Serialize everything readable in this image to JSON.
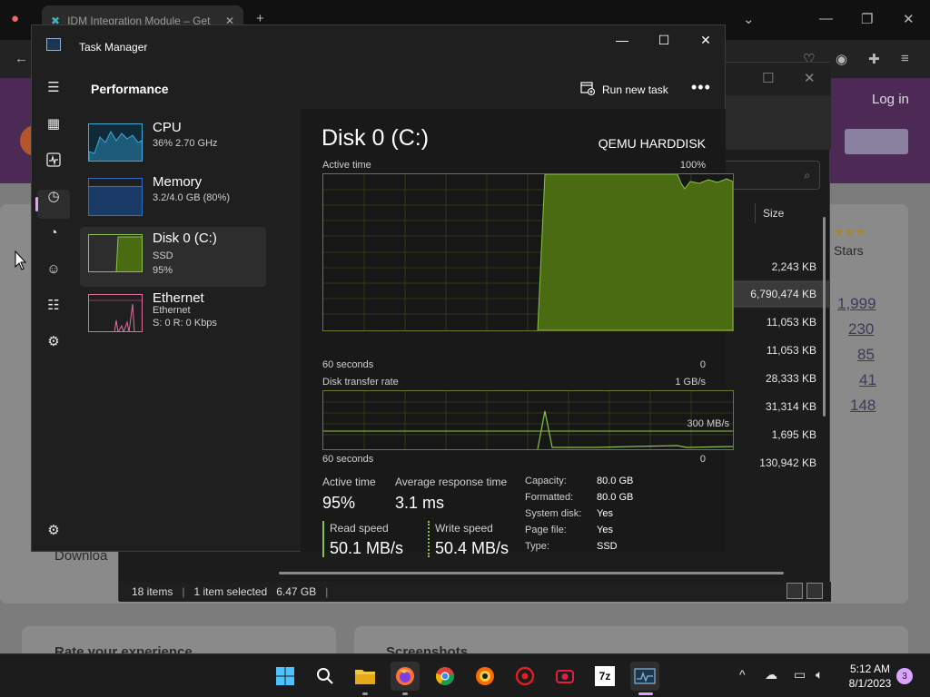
{
  "browser": {
    "tab_title": "IDM Integration Module – Get",
    "login": "Log in",
    "download": "Downloa",
    "rate_heading": "Rate your experience",
    "screenshots_heading": "Screenshots",
    "stars_label": "Stars",
    "ratings": [
      "1,999",
      "230",
      "85",
      "41",
      "148"
    ]
  },
  "explorer": {
    "column_size": "Size",
    "sizes": [
      "2,243 KB",
      "6,790,474 KB",
      "11,053 KB",
      "11,053 KB",
      "28,333 KB",
      "31,314 KB",
      "1,695 KB",
      "130,942 KB"
    ],
    "status_items": "18 items",
    "status_selected": "1 item selected",
    "status_size": "6.47 GB"
  },
  "taskmanager": {
    "title": "Task Manager",
    "header": "Performance",
    "run_new_task": "Run new task",
    "items": [
      {
        "name": "CPU",
        "sub1": "36%  2.70 GHz",
        "sub2": "",
        "sub3": ""
      },
      {
        "name": "Memory",
        "sub1": "3.2/4.0 GB (80%)",
        "sub2": "",
        "sub3": ""
      },
      {
        "name": "Disk 0 (C:)",
        "sub1": "SSD",
        "sub2": "95%",
        "sub3": ""
      },
      {
        "name": "Ethernet",
        "sub1": "Ethernet",
        "sub2": "S: 0  R: 0 Kbps",
        "sub3": ""
      }
    ],
    "disk": {
      "title": "Disk 0 (C:)",
      "model": "QEMU HARDDISK",
      "active_time_label": "Active time",
      "active_time_max": "100%",
      "seconds_label": "60 seconds",
      "zero": "0",
      "transfer_label": "Disk transfer rate",
      "transfer_max": "1 GB/s",
      "transfer_mid": "300 MB/s",
      "stats": {
        "active_time_label": "Active time",
        "active_time": "95%",
        "avg_resp_label": "Average response time",
        "avg_resp": "3.1 ms",
        "read_label": "Read speed",
        "read": "50.1 MB/s",
        "write_label": "Write speed",
        "write": "50.4 MB/s"
      },
      "props": [
        {
          "k": "Capacity:",
          "v": "80.0 GB"
        },
        {
          "k": "Formatted:",
          "v": "80.0 GB"
        },
        {
          "k": "System disk:",
          "v": "Yes"
        },
        {
          "k": "Page file:",
          "v": "Yes"
        },
        {
          "k": "Type:",
          "v": "SSD"
        }
      ]
    }
  },
  "taskbar": {
    "time": "5:12 AM",
    "date": "8/1/2023",
    "notifications": "3",
    "apps": [
      "start-icon",
      "search-icon",
      "file-explorer-icon",
      "firefox-icon",
      "chrome-icon",
      "brave-icon",
      "recorder-icon",
      "camera-icon",
      "7zip-icon",
      "task-manager-icon"
    ],
    "seven_zip": "7z"
  },
  "colors": {
    "disk_green": "#8bc34a",
    "disk_fill": "#4a6b12",
    "accent": "#d9a4ff",
    "cpu_blue": "#3fa9d9",
    "mem_blue": "#2d6fc4",
    "eth_pink": "#d9709c"
  }
}
